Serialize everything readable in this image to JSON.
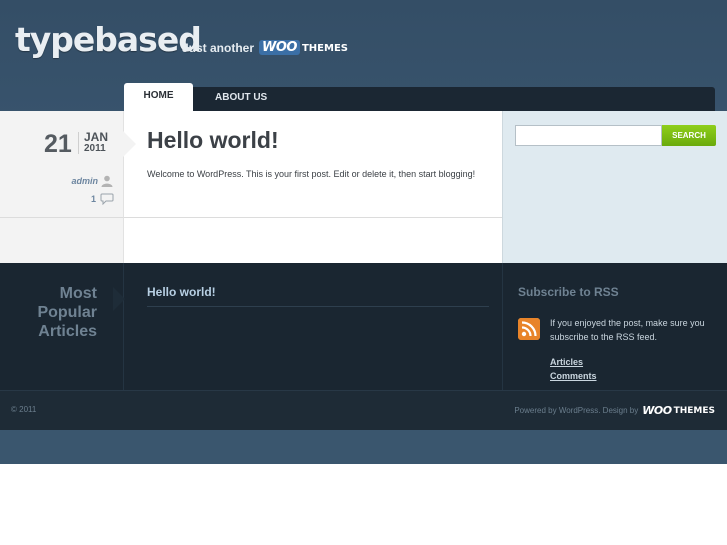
{
  "header": {
    "logo": "typebased",
    "tagline_prefix": "Just another",
    "tagline_woo": "WOO",
    "tagline_themes": "THEMES"
  },
  "nav": {
    "items": [
      {
        "label": "HOME",
        "active": true
      },
      {
        "label": "ABOUT US",
        "active": false
      }
    ]
  },
  "post": {
    "day": "21",
    "month": "JAN",
    "year": "2011",
    "author": "admin",
    "comments": "1",
    "title": "Hello world!",
    "body": "Welcome to WordPress. This is your first post. Edit or delete it, then start blogging!"
  },
  "sidebar": {
    "search_button": "SEARCH",
    "search_value": ""
  },
  "widgets": {
    "popular_title": "Most Popular Articles",
    "popular_items": [
      "Hello world!"
    ],
    "rss_title": "Subscribe to RSS",
    "rss_text": "If you enjoyed the post, make sure you subscribe to the RSS feed.",
    "rss_links": [
      "Articles",
      "Comments"
    ]
  },
  "footer": {
    "copyright": "© 2011",
    "credits": "Powered by WordPress. Design by",
    "credits_woo": "WOO",
    "credits_themes": "THEMES"
  },
  "colors": {
    "header_bg": "#3a5670",
    "nav_bg": "#1b2733",
    "search_button": "#7bbd14",
    "widget_bg": "#1a2631",
    "rss_orange": "#e0781c"
  },
  "icons": {
    "user": "user-icon",
    "comment": "comment-bubble-icon",
    "rss": "rss-feed-icon"
  }
}
